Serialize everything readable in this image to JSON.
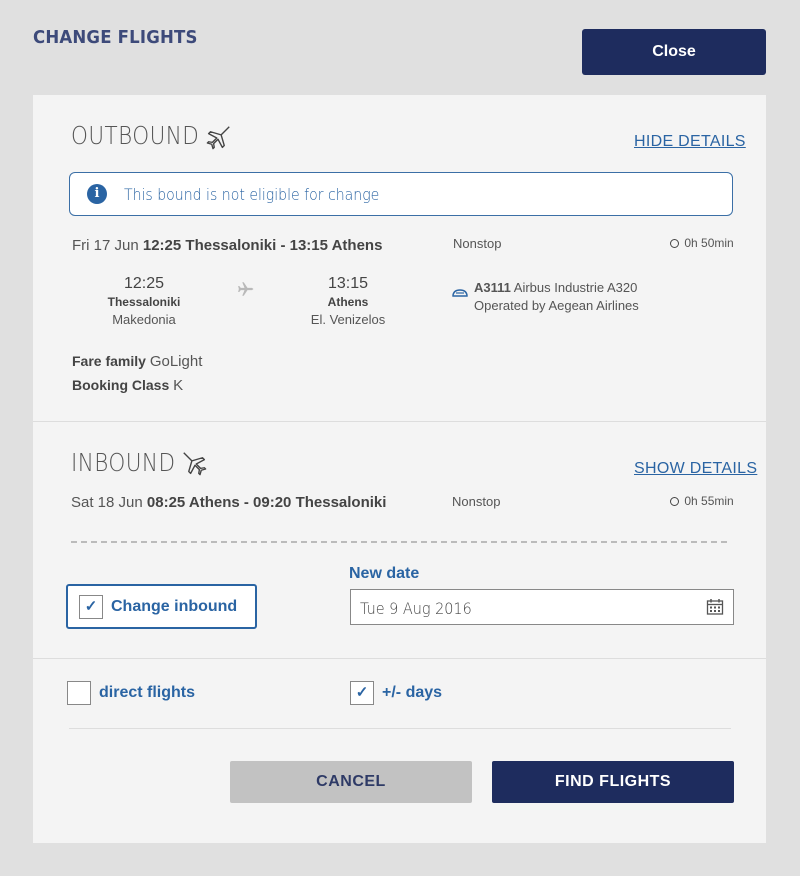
{
  "dialog": {
    "title": "CHANGE FLIGHTS",
    "close_label": "Close"
  },
  "outbound": {
    "title": "OUTBOUND",
    "details_link": "HIDE DETAILS",
    "notice": "This bound is not eligible for change",
    "summary_date": "Fri 17 Jun",
    "summary_route": "12:25 Thessaloniki - 13:15 Athens",
    "stops": "Nonstop",
    "duration": "0h 50min",
    "depart_time": "12:25",
    "depart_city": "Thessaloniki",
    "depart_airport": "Makedonia",
    "arrive_time": "13:15",
    "arrive_city": "Athens",
    "arrive_airport": "El. Venizelos",
    "flight_number": "A3111",
    "aircraft": "Airbus Industrie A320",
    "operator": "Operated by Aegean Airlines",
    "fare_family_label": "Fare family",
    "fare_family_value": "GoLight",
    "booking_class_label": "Booking Class",
    "booking_class_value": "K"
  },
  "inbound": {
    "title": "INBOUND",
    "details_link": "SHOW DETAILS",
    "summary_date": "Sat 18 Jun",
    "summary_route": "08:25 Athens - 09:20 Thessaloniki",
    "stops": "Nonstop",
    "duration": "0h 55min",
    "change_label": "Change inbound",
    "change_checked": true,
    "new_date_label": "New date",
    "new_date_value": "Tue 9 Aug 2016"
  },
  "filters": {
    "direct_label": "direct flights",
    "direct_checked": false,
    "flex_label": "+/- days",
    "flex_checked": true,
    "check_mark": "✓"
  },
  "actions": {
    "cancel_label": "CANCEL",
    "find_label": "FIND FLIGHTS"
  },
  "colors": {
    "navy": "#1e2c5e",
    "link_blue": "#2a64a3",
    "panel": "#f4f4f4",
    "backdrop": "#e0e0e0"
  }
}
